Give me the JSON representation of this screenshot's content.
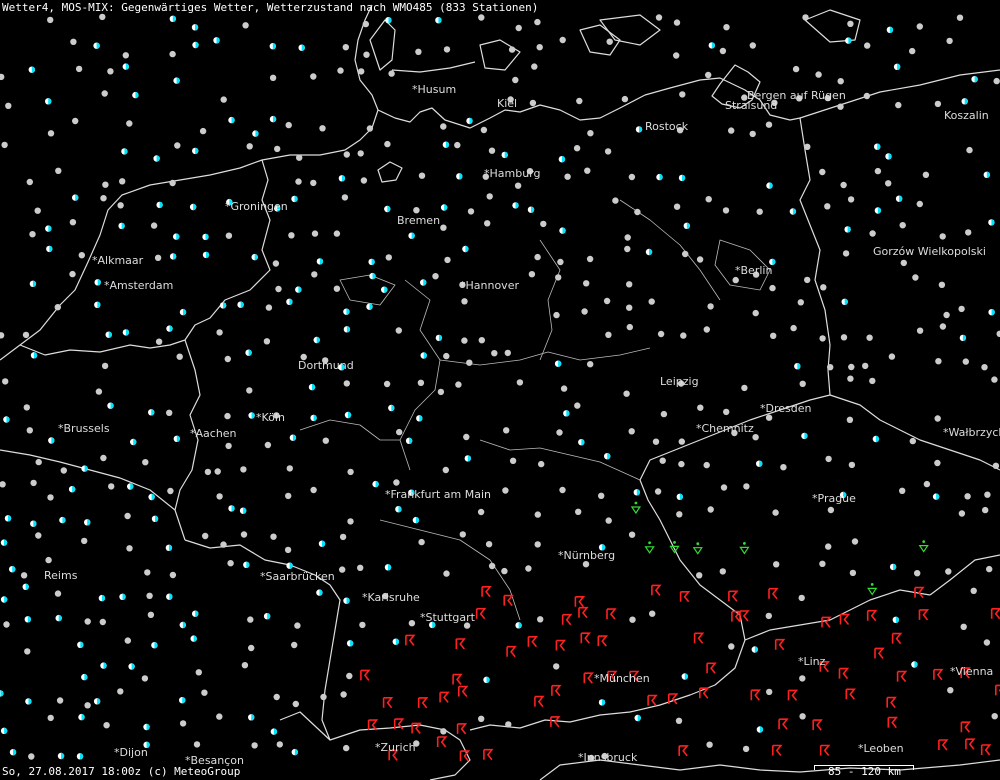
{
  "header": {
    "title": "Wetter4, MOS-MIX: Gegenwärtiges Wetter, Wetterzustand nach WMO485 (833 Stationen)"
  },
  "footer": {
    "timestamp": "So, 27.08.2017 18:00z (c) MeteoGroup",
    "scale": "85 - 120 km"
  },
  "colors": {
    "background": "#000000",
    "borders": "#ffffff",
    "cloud": "#cccccc",
    "partly": "#00e5ff",
    "thunder": "#ff2020",
    "shower": "#33dd33"
  },
  "legend_symbols": {
    "cloud": "grey circle (overcast)",
    "partly": "cyan half-filled circle (partly cloudy)",
    "thunder": "red thunderstorm symbol",
    "shower": "green rain shower triangle",
    "drizzle": "green dots"
  },
  "cities": [
    {
      "name": "Husum"
    },
    {
      "name": "Kiel"
    },
    {
      "name": "Bergen auf Rügen"
    },
    {
      "name": "Stralsund"
    },
    {
      "name": "Rostock"
    },
    {
      "name": "Koszalin"
    },
    {
      "name": "Hamburg"
    },
    {
      "name": "Groningen"
    },
    {
      "name": "Bremen"
    },
    {
      "name": "Alkmaar"
    },
    {
      "name": "Amsterdam"
    },
    {
      "name": "Hannover"
    },
    {
      "name": "Berlin"
    },
    {
      "name": "Gorzów Wielkopolski"
    },
    {
      "name": "Dortmund"
    },
    {
      "name": "Leipzig"
    },
    {
      "name": "Brussels"
    },
    {
      "name": "Aachen"
    },
    {
      "name": "Köln"
    },
    {
      "name": "Dresden"
    },
    {
      "name": "Chemnitz"
    },
    {
      "name": "Wałbrzych"
    },
    {
      "name": "Frankfurt am Main"
    },
    {
      "name": "Prague"
    },
    {
      "name": "Nürnberg"
    },
    {
      "name": "Reims"
    },
    {
      "name": "Saarbrücken"
    },
    {
      "name": "Karlsruhe"
    },
    {
      "name": "Stuttgart"
    },
    {
      "name": "Linz"
    },
    {
      "name": "München"
    },
    {
      "name": "Vienna"
    },
    {
      "name": "Dijon"
    },
    {
      "name": "Besançon"
    },
    {
      "name": "Zurich"
    },
    {
      "name": "Innsbruck"
    },
    {
      "name": "Leoben"
    }
  ]
}
